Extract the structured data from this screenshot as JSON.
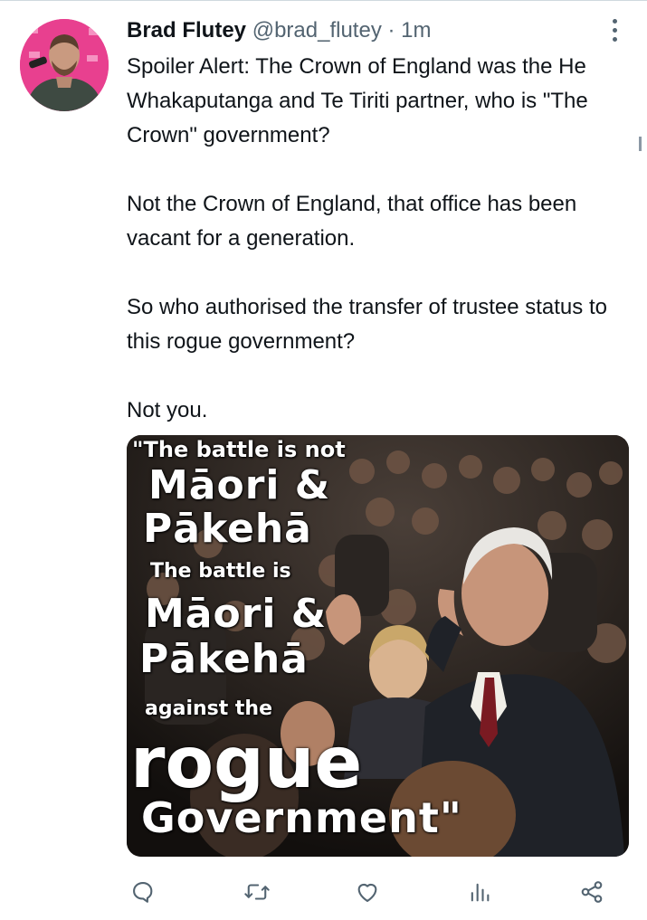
{
  "tweet": {
    "author_name": "Brad Flutey",
    "author_handle": "@brad_flutey",
    "separator": "·",
    "timestamp": "1m",
    "paragraphs": [
      "Spoiler Alert: The Crown of England was the He Whakaputanga and Te Tiriti partner, who is \"The Crown\" government?",
      "Not the Crown of England, that office has been vacant for a generation.",
      "So who authorised the transfer of trustee status to this rogue government?",
      "Not you."
    ],
    "media": {
      "overlay_lines": [
        "\"The battle is not",
        "Māori &",
        "Pākehā",
        "The battle is",
        "Māori &",
        "Pākehā",
        "against the",
        "rogue",
        "Government\""
      ]
    }
  },
  "icons": {
    "avatar": "profile-photo",
    "more": "more-options-icon",
    "reply": "reply-icon",
    "retweet": "retweet-icon",
    "like": "heart-icon",
    "views": "bar-chart-icon",
    "share": "share-icon"
  },
  "colors": {
    "text_primary": "#0f1419",
    "text_secondary": "#536471",
    "avatar_background": "#e8408f"
  }
}
